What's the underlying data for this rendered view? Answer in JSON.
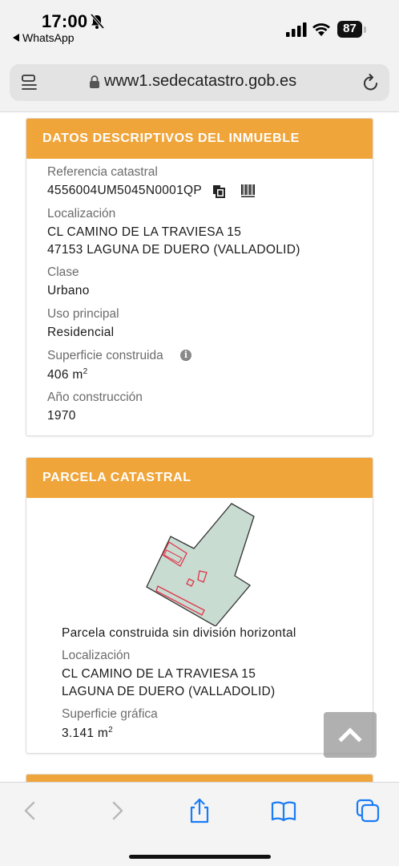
{
  "status_bar": {
    "time": "17:00",
    "back_label": "WhatsApp",
    "battery": "87"
  },
  "browser": {
    "url": "www1.sedecatastro.gob.es"
  },
  "inmueble": {
    "header": "DATOS DESCRIPTIVOS DEL INMUEBLE",
    "ref_label": "Referencia catastral",
    "ref_value": "4556004UM5045N0001QP",
    "loc_label": "Localización",
    "loc_line1": "CL CAMINO DE LA TRAVIESA 15",
    "loc_line2": "47153 LAGUNA DE DUERO (VALLADOLID)",
    "clase_label": "Clase",
    "clase_value": "Urbano",
    "uso_label": "Uso principal",
    "uso_value": "Residencial",
    "sup_label": "Superficie construida",
    "sup_value": "406 m",
    "sup_unit_exp": "2",
    "anio_label": "Año construcción",
    "anio_value": "1970"
  },
  "parcela": {
    "header": "PARCELA CATASTRAL",
    "tipo": "Parcela construida sin división horizontal",
    "loc_label": "Localización",
    "loc_line1": "CL CAMINO DE LA TRAVIESA 15",
    "loc_line2": "LAGUNA DE DUERO (VALLADOLID)",
    "sup_label": "Superficie gráfica",
    "sup_value": "3.141 m",
    "sup_unit_exp": "2",
    "colors": {
      "fill": "#c9dcd2",
      "outline": "#333333",
      "buildings": "#e0344a"
    }
  },
  "colors": {
    "header_orange": "#f0a53a",
    "card_border": "#dddddd",
    "label_gray": "#6b6b6b",
    "toolbar_blue": "#1a7cf5"
  },
  "icons": {
    "menu": "reader-menu-icon",
    "lock": "lock-icon",
    "reload": "reload-icon",
    "copy": "copy-icon",
    "barcode": "barcode-icon",
    "info": "info-icon",
    "to_top": "chevron-up-icon",
    "back": "chevron-left-icon",
    "forward": "chevron-right-icon",
    "share": "share-icon",
    "bookmarks": "book-icon",
    "tabs": "tabs-icon"
  }
}
